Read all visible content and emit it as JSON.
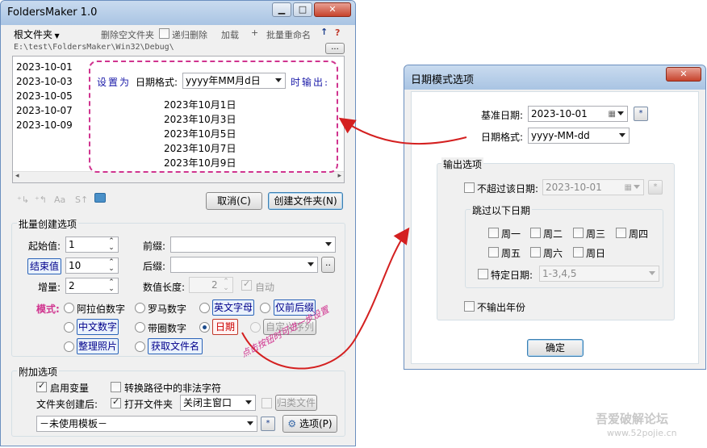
{
  "main_window": {
    "title": "FoldersMaker 1.0",
    "menu": {
      "root": "根文件夹",
      "delete_empty": "删除空文件夹",
      "recursive_delete": "递归删除",
      "load": "加载",
      "plus": "+",
      "batch_rename": "批量重命名",
      "up": "↑",
      "help": "?"
    },
    "path": "E:\\test\\FoldersMaker\\Win32\\Debug\\",
    "path_button": "...",
    "folder_list": [
      "2023-10-01",
      "2023-10-03",
      "2023-10-05",
      "2023-10-07",
      "2023-10-09"
    ],
    "cancel_button": "取消(C)",
    "create_button": "创建文件夹(N)",
    "batch_section": {
      "title": "批量创建选项",
      "start_label": "起始值:",
      "start_value": "1",
      "end_button": "结束值",
      "end_value": "10",
      "step_label": "增量:",
      "step_value": "2",
      "prefix_label": "前缀:",
      "suffix_label": "后缀:",
      "suffix_button": "..",
      "length_label": "数值长度:",
      "length_value": "2",
      "auto_label": "自动",
      "mode_label": "模式:",
      "modes": {
        "arabic": "阿拉伯数字",
        "roman": "罗马数字",
        "english": "英文字母",
        "only_prefix_suffix": "仅前后缀",
        "chinese": "中文数字",
        "circled": "带圈数字",
        "date": "日期",
        "custom": "自定义序列",
        "organize_photos": "整理照片",
        "get_filenames": "获取文件名"
      }
    },
    "extra_section": {
      "title": "附加选项",
      "enable_vars": "启用变量",
      "convert_illegal": "转换路径中的非法字符",
      "after_create_label": "文件夹创建后:",
      "open_folder": "打开文件夹",
      "close_main_option": "关闭主窗口",
      "classify_files": "归类文件",
      "template_select": "－未使用模板－",
      "star_button": "*",
      "options_button": "选项(P)"
    }
  },
  "annotation": {
    "set_as": "设置为",
    "date_format_label": "日期格式:",
    "date_format_value": "yyyy年MM月d日",
    "output_when": "时输出:",
    "output_list": [
      "2023年10月1日",
      "2023年10月3日",
      "2023年10月5日",
      "2023年10月7日",
      "2023年10月9日"
    ],
    "curve_note": "点击按钮时可进一步设置"
  },
  "date_dialog": {
    "title": "日期模式选项",
    "base_date_label": "基准日期:",
    "base_date_value": "2023-10-01",
    "star_button": "*",
    "format_label": "日期格式:",
    "format_value": "yyyy-MM-dd",
    "output_group": "输出选项",
    "not_exceed_label": "不超过该日期:",
    "not_exceed_value": "2023-10-01",
    "skip_group": "跳过以下日期",
    "weekdays": [
      "周一",
      "周二",
      "周三",
      "周四",
      "周五",
      "周六",
      "周日"
    ],
    "specific_date_label": "特定日期:",
    "specific_date_value": "1-3,4,5",
    "no_year_label": "不输出年份",
    "ok_button": "确定"
  },
  "watermark": {
    "line1": "吾爱破解论坛",
    "line2": "www.52pojie.cn"
  },
  "colors": {
    "accent_blue": "#00008b",
    "annotation_magenta": "#d0348f",
    "arrow_red": "#d42020"
  }
}
